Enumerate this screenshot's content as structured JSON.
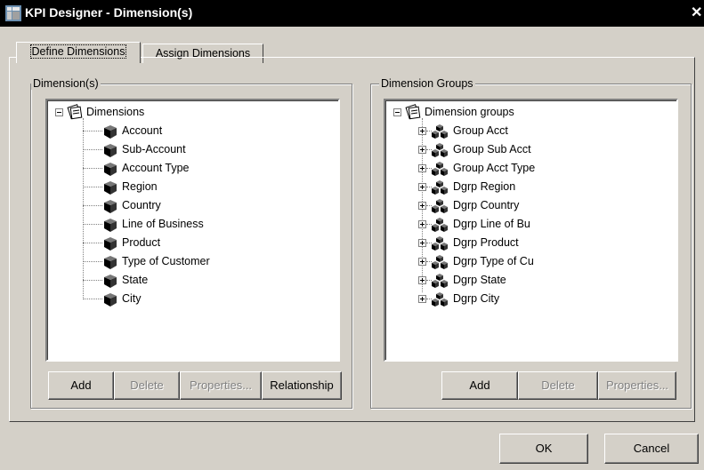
{
  "window": {
    "title": "KPI Designer - Dimension(s)",
    "close_glyph": "✕"
  },
  "tabs": [
    {
      "label": "Define Dimensions",
      "active": true
    },
    {
      "label": "Assign Dimensions",
      "active": false
    }
  ],
  "dimensions_panel": {
    "legend": "Dimension(s)",
    "root": {
      "label": "Dimensions",
      "icon": "database-icon"
    },
    "items": [
      "Account",
      "Sub-Account",
      "Account Type",
      "Region",
      "Country",
      "Line of Business",
      "Product",
      "Type of Customer",
      "State",
      "City"
    ],
    "buttons": {
      "add": "Add",
      "delete": "Delete",
      "properties": "Properties...",
      "relationship": "Relationship"
    }
  },
  "groups_panel": {
    "legend": "Dimension Groups",
    "root": {
      "label": "Dimension groups",
      "icon": "database-icon"
    },
    "items": [
      "Group Acct",
      "Group Sub Acct",
      "Group Acct Type",
      "Dgrp Region",
      "Dgrp Country",
      "Dgrp Line of Bu",
      "Dgrp Product",
      "Dgrp Type of Cu",
      "Dgrp State",
      "Dgrp City"
    ],
    "buttons": {
      "add": "Add",
      "delete": "Delete",
      "properties": "Properties..."
    }
  },
  "footer": {
    "ok": "OK",
    "cancel": "Cancel"
  }
}
